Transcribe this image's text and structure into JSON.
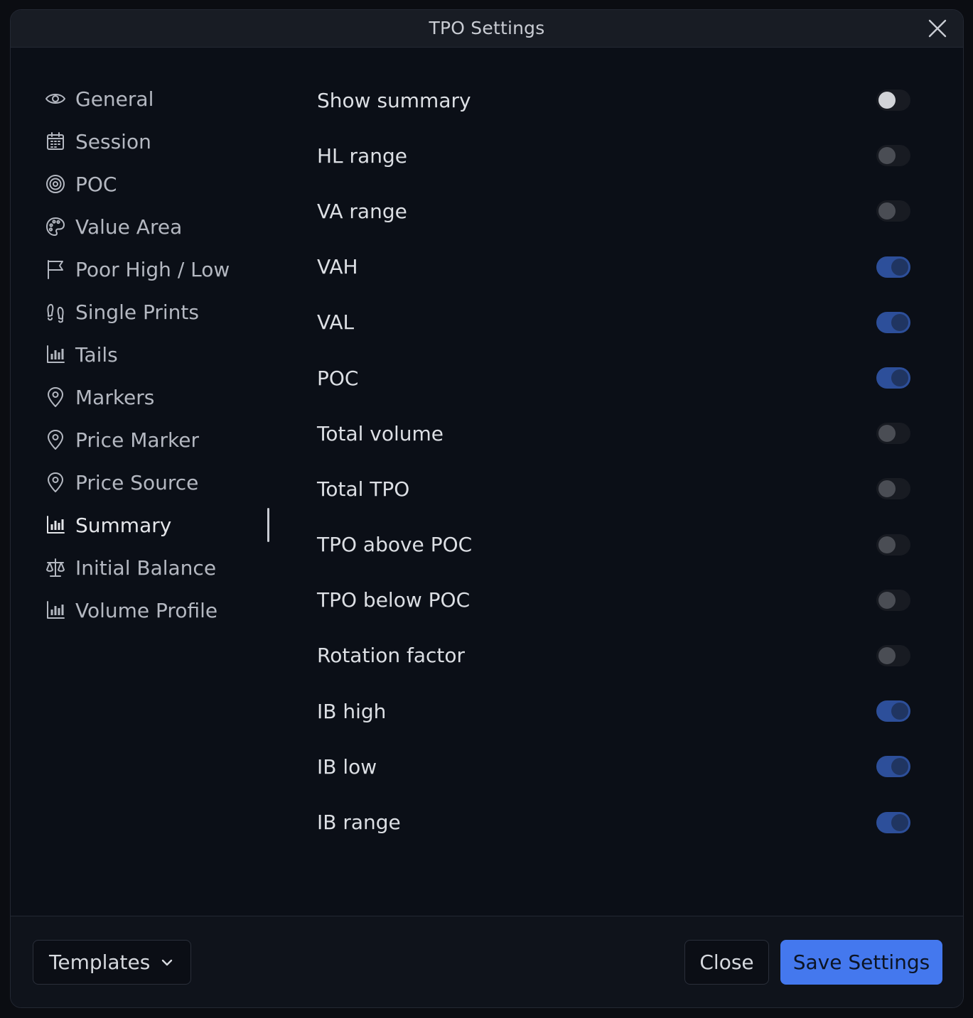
{
  "window": {
    "title": "TPO Settings"
  },
  "sidebar": {
    "items": [
      {
        "label": "General",
        "icon": "eye-icon",
        "active": false
      },
      {
        "label": "Session",
        "icon": "calendar-icon",
        "active": false
      },
      {
        "label": "POC",
        "icon": "target-icon",
        "active": false
      },
      {
        "label": "Value Area",
        "icon": "palette-icon",
        "active": false
      },
      {
        "label": "Poor High / Low",
        "icon": "flag-icon",
        "active": false
      },
      {
        "label": "Single Prints",
        "icon": "footprints-icon",
        "active": false
      },
      {
        "label": "Tails",
        "icon": "bar-chart-icon",
        "active": false
      },
      {
        "label": "Markers",
        "icon": "map-pin-icon",
        "active": false
      },
      {
        "label": "Price Marker",
        "icon": "map-pin-icon",
        "active": false
      },
      {
        "label": "Price Source",
        "icon": "map-pin-icon",
        "active": false
      },
      {
        "label": "Summary",
        "icon": "bar-chart-icon",
        "active": true
      },
      {
        "label": "Initial Balance",
        "icon": "scale-icon",
        "active": false
      },
      {
        "label": "Volume Profile",
        "icon": "bar-chart-icon",
        "active": false
      }
    ]
  },
  "summary": {
    "rows": [
      {
        "label": "Show summary",
        "on": false
      },
      {
        "label": "HL range",
        "on": false
      },
      {
        "label": "VA range",
        "on": false
      },
      {
        "label": "VAH",
        "on": true
      },
      {
        "label": "VAL",
        "on": true
      },
      {
        "label": "POC",
        "on": true
      },
      {
        "label": "Total volume",
        "on": false
      },
      {
        "label": "Total TPO",
        "on": false
      },
      {
        "label": "TPO above POC",
        "on": false
      },
      {
        "label": "TPO below POC",
        "on": false
      },
      {
        "label": "Rotation factor",
        "on": false
      },
      {
        "label": "IB high",
        "on": true
      },
      {
        "label": "IB low",
        "on": true
      },
      {
        "label": "IB range",
        "on": true
      }
    ]
  },
  "footer": {
    "templates_label": "Templates",
    "close_label": "Close",
    "save_label": "Save Settings"
  },
  "colors": {
    "accent": "#4478ee",
    "toggle_on": "#2d4f9a",
    "background": "#0b0f17"
  }
}
